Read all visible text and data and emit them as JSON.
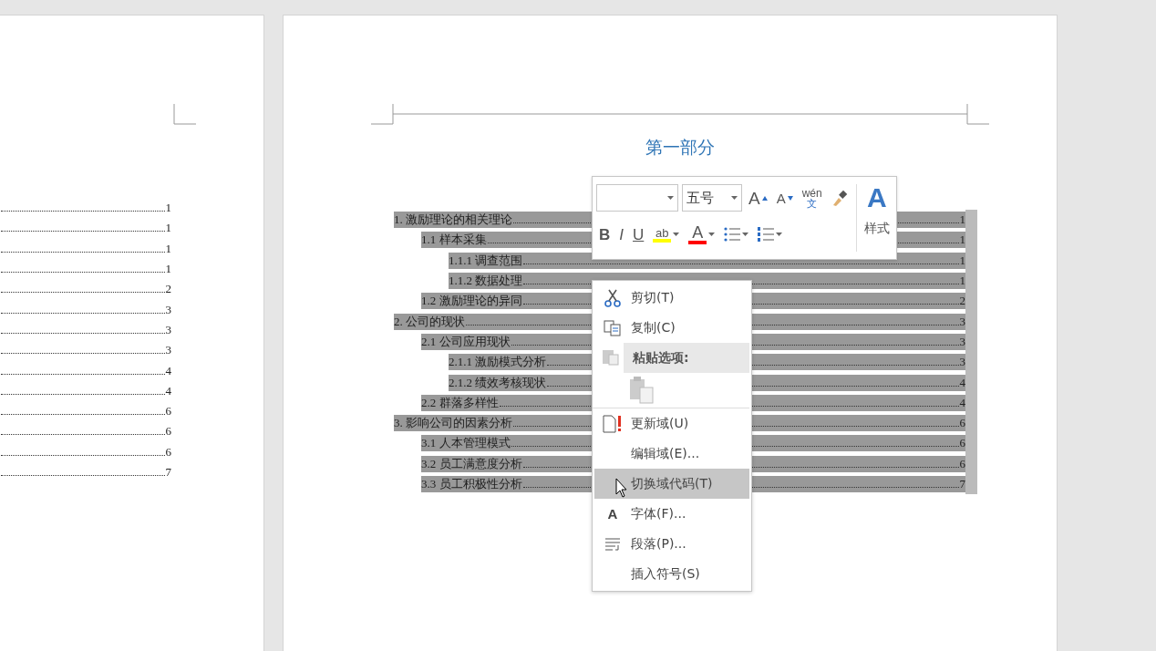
{
  "left_page": {
    "toc": [
      {
        "page": "1"
      },
      {
        "page": "1"
      },
      {
        "page": "1"
      },
      {
        "page": "1"
      },
      {
        "page": "2"
      },
      {
        "page": "3"
      },
      {
        "page": "3"
      },
      {
        "page": "3"
      },
      {
        "page": "4"
      },
      {
        "page": "4"
      },
      {
        "page": "6"
      },
      {
        "page": "6"
      },
      {
        "page": "6"
      },
      {
        "page": "7"
      }
    ]
  },
  "right_page": {
    "heading": "第一部分",
    "toc": {
      "selected": true,
      "entries": [
        {
          "title": "1.  激励理论的相关理论",
          "page": "1",
          "children": [
            {
              "title": "1.1  样本采集",
              "page": "1",
              "children": [
                {
                  "title": "1.1.1  调查范围",
                  "page": "1"
                },
                {
                  "title": "1.1.2  数据处理",
                  "page": "1"
                }
              ]
            },
            {
              "title": "1.2  激励理论的异同",
              "page": "2"
            }
          ]
        },
        {
          "title": "2.  公司的现状",
          "page": "3",
          "children": [
            {
              "title": "2.1  公司应用现状",
              "page": "3",
              "children": [
                {
                  "title": "2.1.1  激励模式分析",
                  "page": "3"
                },
                {
                  "title": "2.1.2  绩效考核现状",
                  "page": "4"
                }
              ]
            },
            {
              "title": "2.2  群落多样性",
              "page": "4"
            }
          ]
        },
        {
          "title": "3.  影响公司的因素分析",
          "page": "6",
          "children": [
            {
              "title": "3.1  人本管理模式",
              "page": "6"
            },
            {
              "title": "3.2  员工满意度分析",
              "page": "6"
            },
            {
              "title": "3.3  员工积极性分析",
              "page": "7"
            }
          ]
        }
      ]
    }
  },
  "mini_toolbar": {
    "font_size": "五号",
    "row1": [
      {
        "kind": "grow",
        "label": "A"
      },
      {
        "kind": "shrink",
        "label": "A"
      },
      {
        "kind": "phonetic",
        "label": "wén",
        "sub": "文"
      },
      {
        "kind": "painter"
      }
    ],
    "row2": [
      {
        "kind": "bold",
        "label": "B"
      },
      {
        "kind": "italic",
        "label": "I"
      },
      {
        "kind": "underline",
        "label": "U"
      },
      {
        "kind": "highlight",
        "label": "ab",
        "color": "#ffff00"
      },
      {
        "kind": "font_color",
        "label": "A",
        "color": "#ff0000"
      },
      {
        "kind": "bullets"
      },
      {
        "kind": "numbering"
      }
    ],
    "styles": {
      "glyph": "A",
      "label": "样式"
    }
  },
  "context_menu": [
    {
      "kind": "cut",
      "label": "剪切(T)",
      "selected": false
    },
    {
      "kind": "copy",
      "label": "复制(C)",
      "selected": false
    },
    {
      "kind": "section",
      "label": "粘贴选项:"
    },
    {
      "kind": "paste"
    },
    {
      "kind": "update",
      "label": "更新域(U)",
      "selected": false
    },
    {
      "kind": "plain",
      "label": "编辑域(E)...",
      "selected": false
    },
    {
      "kind": "plain",
      "label": "切换域代码(T)",
      "selected": true
    },
    {
      "kind": "font",
      "glyph": "A",
      "label": "字体(F)...",
      "selected": false
    },
    {
      "kind": "paragraph",
      "label": "段落(P)...",
      "selected": false
    },
    {
      "kind": "plain",
      "label": "插入符号(S)",
      "selected": false
    }
  ]
}
